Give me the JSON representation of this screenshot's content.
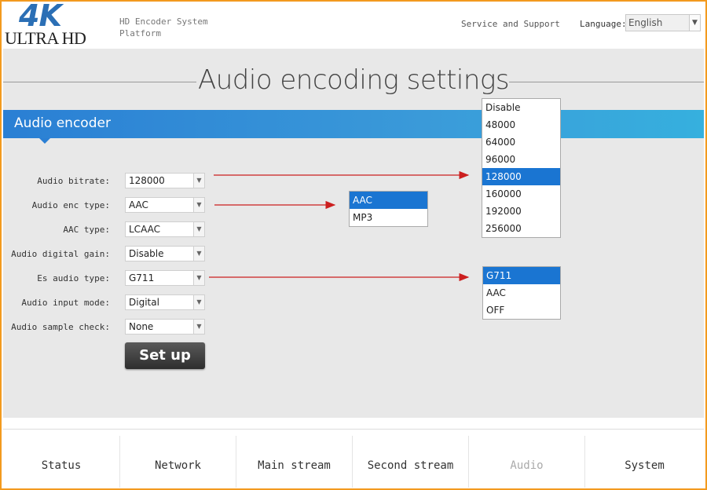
{
  "header": {
    "logo_main": "4K",
    "logo_sub": "ULTRA HD",
    "platform_title": "HD Encoder System Platform",
    "support_link": "Service and Support",
    "language_label": "Language:",
    "language_value": "English"
  },
  "page": {
    "title": "Audio encoding settings",
    "section": "Audio encoder"
  },
  "form": {
    "rows": [
      {
        "label": "Audio bitrate:",
        "value": "128000"
      },
      {
        "label": "Audio enc type:",
        "value": "AAC"
      },
      {
        "label": "AAC type:",
        "value": "LCAAC"
      },
      {
        "label": "Audio digital gain:",
        "value": "Disable"
      },
      {
        "label": "Es audio type:",
        "value": "G711"
      },
      {
        "label": "Audio input mode:",
        "value": "Digital"
      },
      {
        "label": "Audio sample check:",
        "value": "None"
      }
    ],
    "submit_label": "Set up"
  },
  "dropdowns": {
    "bitrate": {
      "options": [
        "Disable",
        "48000",
        "64000",
        "96000",
        "128000",
        "160000",
        "192000",
        "256000"
      ],
      "selected": "128000"
    },
    "enc_type": {
      "options": [
        "AAC",
        "MP3"
      ],
      "selected": "AAC"
    },
    "es_type": {
      "options": [
        "G711",
        "AAC",
        "OFF"
      ],
      "selected": "G711"
    }
  },
  "annotation_color": "#cc1f1f",
  "accent_color": "#1a75d2",
  "nav": {
    "items": [
      "Status",
      "Network",
      "Main stream",
      "Second stream",
      "Audio",
      "System"
    ],
    "active": "Audio"
  }
}
